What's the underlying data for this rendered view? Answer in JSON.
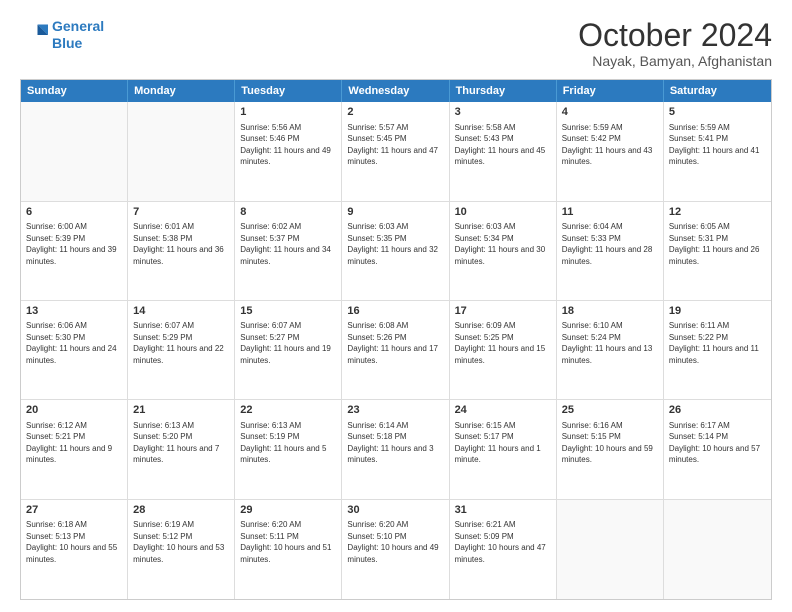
{
  "logo": {
    "line1": "General",
    "line2": "Blue"
  },
  "title": "October 2024",
  "location": "Nayak, Bamyan, Afghanistan",
  "weekdays": [
    "Sunday",
    "Monday",
    "Tuesday",
    "Wednesday",
    "Thursday",
    "Friday",
    "Saturday"
  ],
  "weeks": [
    [
      {
        "day": "",
        "info": ""
      },
      {
        "day": "",
        "info": ""
      },
      {
        "day": "1",
        "info": "Sunrise: 5:56 AM\nSunset: 5:46 PM\nDaylight: 11 hours and 49 minutes."
      },
      {
        "day": "2",
        "info": "Sunrise: 5:57 AM\nSunset: 5:45 PM\nDaylight: 11 hours and 47 minutes."
      },
      {
        "day": "3",
        "info": "Sunrise: 5:58 AM\nSunset: 5:43 PM\nDaylight: 11 hours and 45 minutes."
      },
      {
        "day": "4",
        "info": "Sunrise: 5:59 AM\nSunset: 5:42 PM\nDaylight: 11 hours and 43 minutes."
      },
      {
        "day": "5",
        "info": "Sunrise: 5:59 AM\nSunset: 5:41 PM\nDaylight: 11 hours and 41 minutes."
      }
    ],
    [
      {
        "day": "6",
        "info": "Sunrise: 6:00 AM\nSunset: 5:39 PM\nDaylight: 11 hours and 39 minutes."
      },
      {
        "day": "7",
        "info": "Sunrise: 6:01 AM\nSunset: 5:38 PM\nDaylight: 11 hours and 36 minutes."
      },
      {
        "day": "8",
        "info": "Sunrise: 6:02 AM\nSunset: 5:37 PM\nDaylight: 11 hours and 34 minutes."
      },
      {
        "day": "9",
        "info": "Sunrise: 6:03 AM\nSunset: 5:35 PM\nDaylight: 11 hours and 32 minutes."
      },
      {
        "day": "10",
        "info": "Sunrise: 6:03 AM\nSunset: 5:34 PM\nDaylight: 11 hours and 30 minutes."
      },
      {
        "day": "11",
        "info": "Sunrise: 6:04 AM\nSunset: 5:33 PM\nDaylight: 11 hours and 28 minutes."
      },
      {
        "day": "12",
        "info": "Sunrise: 6:05 AM\nSunset: 5:31 PM\nDaylight: 11 hours and 26 minutes."
      }
    ],
    [
      {
        "day": "13",
        "info": "Sunrise: 6:06 AM\nSunset: 5:30 PM\nDaylight: 11 hours and 24 minutes."
      },
      {
        "day": "14",
        "info": "Sunrise: 6:07 AM\nSunset: 5:29 PM\nDaylight: 11 hours and 22 minutes."
      },
      {
        "day": "15",
        "info": "Sunrise: 6:07 AM\nSunset: 5:27 PM\nDaylight: 11 hours and 19 minutes."
      },
      {
        "day": "16",
        "info": "Sunrise: 6:08 AM\nSunset: 5:26 PM\nDaylight: 11 hours and 17 minutes."
      },
      {
        "day": "17",
        "info": "Sunrise: 6:09 AM\nSunset: 5:25 PM\nDaylight: 11 hours and 15 minutes."
      },
      {
        "day": "18",
        "info": "Sunrise: 6:10 AM\nSunset: 5:24 PM\nDaylight: 11 hours and 13 minutes."
      },
      {
        "day": "19",
        "info": "Sunrise: 6:11 AM\nSunset: 5:22 PM\nDaylight: 11 hours and 11 minutes."
      }
    ],
    [
      {
        "day": "20",
        "info": "Sunrise: 6:12 AM\nSunset: 5:21 PM\nDaylight: 11 hours and 9 minutes."
      },
      {
        "day": "21",
        "info": "Sunrise: 6:13 AM\nSunset: 5:20 PM\nDaylight: 11 hours and 7 minutes."
      },
      {
        "day": "22",
        "info": "Sunrise: 6:13 AM\nSunset: 5:19 PM\nDaylight: 11 hours and 5 minutes."
      },
      {
        "day": "23",
        "info": "Sunrise: 6:14 AM\nSunset: 5:18 PM\nDaylight: 11 hours and 3 minutes."
      },
      {
        "day": "24",
        "info": "Sunrise: 6:15 AM\nSunset: 5:17 PM\nDaylight: 11 hours and 1 minute."
      },
      {
        "day": "25",
        "info": "Sunrise: 6:16 AM\nSunset: 5:15 PM\nDaylight: 10 hours and 59 minutes."
      },
      {
        "day": "26",
        "info": "Sunrise: 6:17 AM\nSunset: 5:14 PM\nDaylight: 10 hours and 57 minutes."
      }
    ],
    [
      {
        "day": "27",
        "info": "Sunrise: 6:18 AM\nSunset: 5:13 PM\nDaylight: 10 hours and 55 minutes."
      },
      {
        "day": "28",
        "info": "Sunrise: 6:19 AM\nSunset: 5:12 PM\nDaylight: 10 hours and 53 minutes."
      },
      {
        "day": "29",
        "info": "Sunrise: 6:20 AM\nSunset: 5:11 PM\nDaylight: 10 hours and 51 minutes."
      },
      {
        "day": "30",
        "info": "Sunrise: 6:20 AM\nSunset: 5:10 PM\nDaylight: 10 hours and 49 minutes."
      },
      {
        "day": "31",
        "info": "Sunrise: 6:21 AM\nSunset: 5:09 PM\nDaylight: 10 hours and 47 minutes."
      },
      {
        "day": "",
        "info": ""
      },
      {
        "day": "",
        "info": ""
      }
    ]
  ]
}
